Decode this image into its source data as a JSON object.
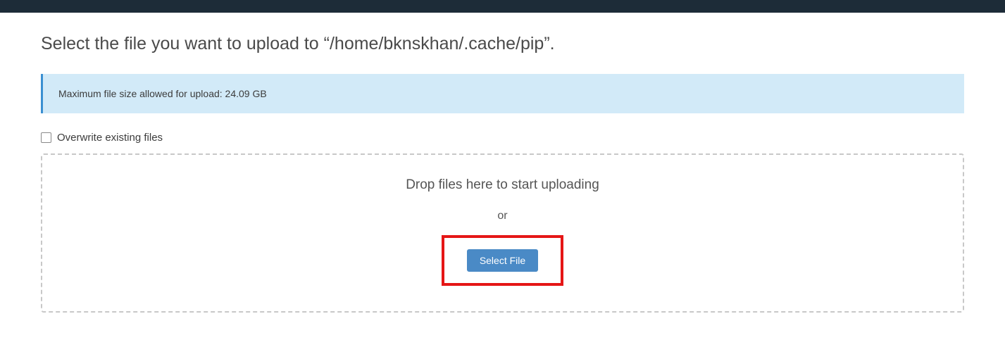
{
  "page": {
    "title": "Select the file you want to upload to “/home/bknskhan/.cache/pip”."
  },
  "info": {
    "max_size_message": "Maximum file size allowed for upload: 24.09 GB"
  },
  "overwrite": {
    "label": "Overwrite existing files",
    "checked": false
  },
  "dropzone": {
    "drop_label": "Drop files here to start uploading",
    "or_label": "or",
    "select_button": "Select File"
  }
}
